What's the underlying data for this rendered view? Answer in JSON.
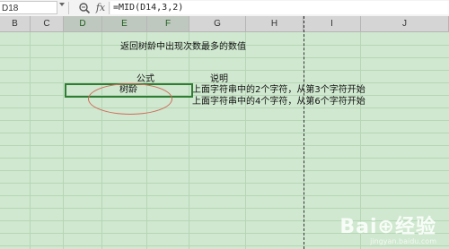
{
  "formula_bar": {
    "name_box": "D18",
    "formula": "=MID(D14,3,2)",
    "zoom_icon": "magnifier-icon",
    "fx_icon": "fx-icon"
  },
  "columns": [
    {
      "label": "B",
      "selected": false
    },
    {
      "label": "C",
      "selected": false
    },
    {
      "label": "D",
      "selected": true
    },
    {
      "label": "E",
      "selected": true
    },
    {
      "label": "F",
      "selected": true
    },
    {
      "label": "G",
      "selected": false
    },
    {
      "label": "H",
      "selected": false
    },
    {
      "label": "I",
      "selected": false
    },
    {
      "label": "J",
      "selected": false
    }
  ],
  "sheet": {
    "title": "返回树龄中出现次数最多的数值",
    "header_formula": "公式",
    "header_desc": "说明",
    "active_cell_value": "树龄",
    "desc_line1": "上面字符串中的2个字符，从第3个字符开始",
    "desc_line2": "上面字符串中的4个字符，从第6个字符开始"
  },
  "watermark": {
    "logo": "Bai⊕经验",
    "url": "jingyan.baidu.com"
  },
  "colors": {
    "grid_bg": "#cfe8cf",
    "active_border": "#2e7d32",
    "ellipse": "#d06a5a"
  }
}
